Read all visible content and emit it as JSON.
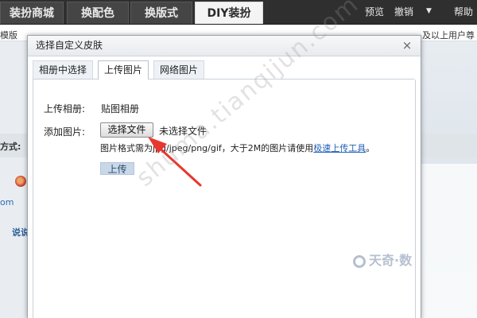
{
  "topbar": {
    "tabs": [
      {
        "label": "装扮商城"
      },
      {
        "label": "换配色"
      },
      {
        "label": "换版式"
      },
      {
        "label": "DIY装扮"
      }
    ],
    "links": {
      "preview": "预览",
      "undo": "撤销",
      "help": "帮助"
    }
  },
  "background": {
    "template_label": "模版",
    "right_note": "及以上用户尊",
    "mode_label": "方式:",
    "om_text": "om",
    "talk_label": "说说"
  },
  "dialog": {
    "title": "选择自定义皮肤",
    "close_label": "×",
    "tabs": [
      {
        "label": "相册中选择"
      },
      {
        "label": "上传图片"
      },
      {
        "label": "网络图片"
      }
    ],
    "upload_album_label": "上传相册:",
    "upload_album_value": "贴图相册",
    "add_image_label": "添加图片:",
    "choose_file_label": "选择文件",
    "no_file_text": "未选择文件",
    "hint_text": "图片格式需为jpg/jpeg/png/gif，大于2M的图片请使用",
    "hint_link": "极速上传工具",
    "hint_end": "。",
    "upload_button": "上传"
  },
  "watermark": {
    "text": "shuma.tianqijun.com",
    "logo_text": "天奇·数"
  },
  "colors": {
    "topbar_bg": "#2f2f2f",
    "link_blue": "#1f5fb8",
    "annotation_red": "#e8372f"
  }
}
